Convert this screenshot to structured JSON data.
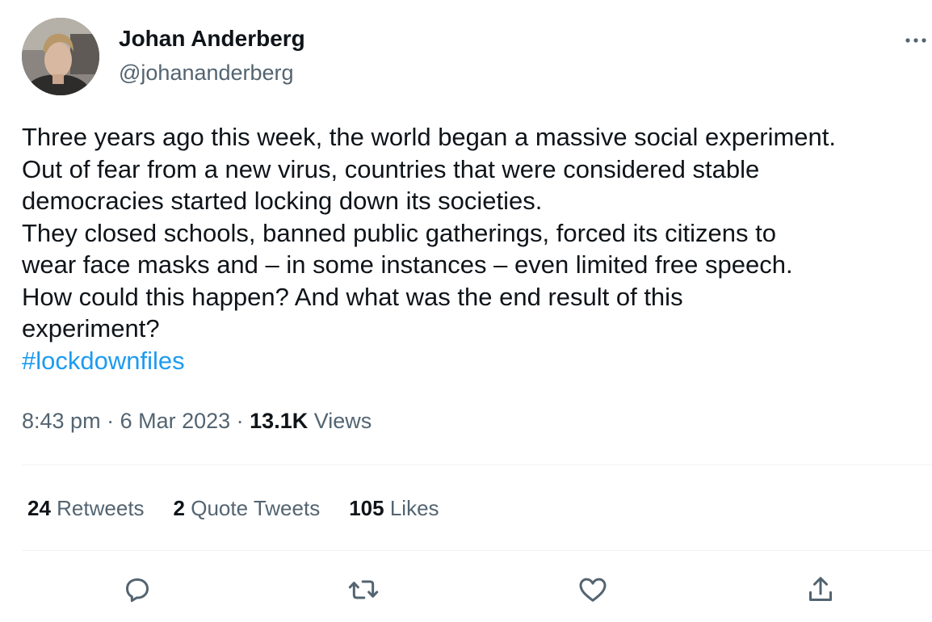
{
  "author": {
    "name": "Johan Anderberg",
    "handle": "@johananderberg"
  },
  "tweet": {
    "lines": [
      "Three years ago this week, the world began a massive social experiment.",
      "Out of fear from a new virus, countries that were considered stable",
      "democracies started locking down its societies.",
      "They closed schools, banned public gatherings, forced its citizens to",
      "wear face masks and – in some instances – even limited free speech.",
      "How could this happen? And what was the end result of this",
      "experiment?"
    ],
    "hashtag": "#lockdownfiles"
  },
  "meta": {
    "time": "8:43 pm",
    "separator": " · ",
    "date": "6 Mar 2023",
    "views_count": "13.1K",
    "views_label": "Views"
  },
  "stats": {
    "retweets_count": "24",
    "retweets_label": "Retweets",
    "quotes_count": "2",
    "quotes_label": "Quote Tweets",
    "likes_count": "105",
    "likes_label": "Likes"
  },
  "icons": {
    "more": "more-horizontal-icon",
    "reply": "reply-icon",
    "retweet": "retweet-icon",
    "like": "heart-icon",
    "share": "share-icon"
  },
  "colors": {
    "text": "#0f1419",
    "secondary": "#536471",
    "link": "#1d9bf0",
    "divider": "#eff3f4"
  }
}
